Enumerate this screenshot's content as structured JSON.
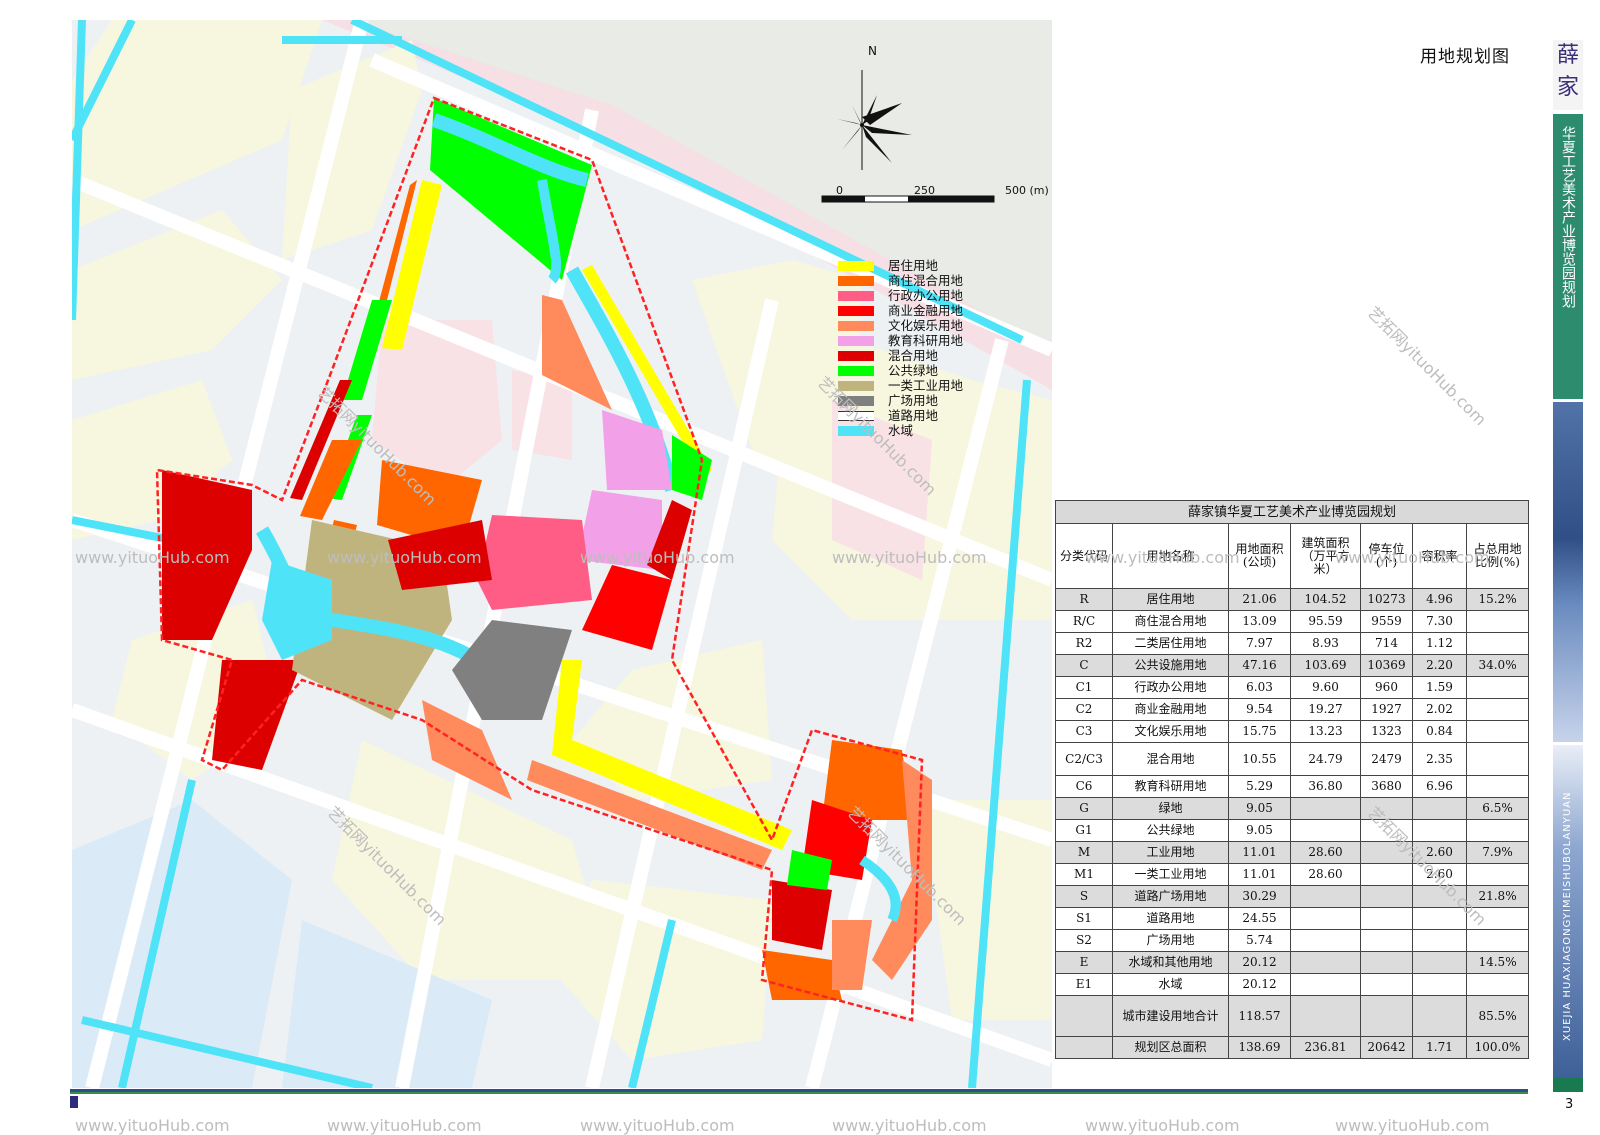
{
  "title": "用地规划图",
  "compass": {
    "north_label": "N"
  },
  "scale_bar": {
    "labels": [
      "0",
      "250",
      "500 (m)"
    ]
  },
  "legend": [
    {
      "label": "居住用地",
      "color": "#ffff00"
    },
    {
      "label": "商住混合用地",
      "color": "#ff6600"
    },
    {
      "label": "行政办公用地",
      "color": "#ff5c86"
    },
    {
      "label": "商业金融用地",
      "color": "#ff0000"
    },
    {
      "label": "文化娱乐用地",
      "color": "#ff8a5c"
    },
    {
      "label": "教育科研用地",
      "color": "#f2a0e8"
    },
    {
      "label": "混合用地",
      "color": "#dd0000"
    },
    {
      "label": "公共绿地",
      "color": "#00ff00"
    },
    {
      "label": "一类工业用地",
      "color": "#c0b47e"
    },
    {
      "label": "广场用地",
      "color": "#808080"
    },
    {
      "label": "道路用地",
      "color": "#ffffff"
    },
    {
      "label": "水域",
      "color": "#4fe3f7"
    }
  ],
  "table": {
    "caption": "薛家镇华夏工艺美术产业博览园规划",
    "headers": [
      "分类代码",
      "用地名称",
      "用地面积(公顷)",
      "建筑面积（万平方米）",
      "停车位(个)",
      "容积率",
      "占总用地比例(%)"
    ],
    "rows": [
      {
        "code": "R",
        "name": "居住用地",
        "area": "21.06",
        "floor": "104.52",
        "parking": "10273",
        "far": "4.96",
        "pct": "15.2%",
        "gray": true
      },
      {
        "code": "R/C",
        "name": "商住混合用地",
        "area": "13.09",
        "floor": "95.59",
        "parking": "9559",
        "far": "7.30",
        "pct": "",
        "gray": false
      },
      {
        "code": "R2",
        "name": "二类居住用地",
        "area": "7.97",
        "floor": "8.93",
        "parking": "714",
        "far": "1.12",
        "pct": "",
        "gray": false
      },
      {
        "code": "C",
        "name": "公共设施用地",
        "area": "47.16",
        "floor": "103.69",
        "parking": "10369",
        "far": "2.20",
        "pct": "34.0%",
        "gray": true
      },
      {
        "code": "C1",
        "name": "行政办公用地",
        "area": "6.03",
        "floor": "9.60",
        "parking": "960",
        "far": "1.59",
        "pct": "",
        "gray": false
      },
      {
        "code": "C2",
        "name": "商业金融用地",
        "area": "9.54",
        "floor": "19.27",
        "parking": "1927",
        "far": "2.02",
        "pct": "",
        "gray": false
      },
      {
        "code": "C3",
        "name": "文化娱乐用地",
        "area": "15.75",
        "floor": "13.23",
        "parking": "1323",
        "far": "0.84",
        "pct": "",
        "gray": false
      },
      {
        "code": "C2/C3",
        "name": "混合用地",
        "area": "10.55",
        "floor": "24.79",
        "parking": "2479",
        "far": "2.35",
        "pct": "",
        "gray": false,
        "tall": true
      },
      {
        "code": "C6",
        "name": "教育科研用地",
        "area": "5.29",
        "floor": "36.80",
        "parking": "3680",
        "far": "6.96",
        "pct": "",
        "gray": false
      },
      {
        "code": "G",
        "name": "绿地",
        "area": "9.05",
        "floor": "",
        "parking": "",
        "far": "",
        "pct": "6.5%",
        "gray": true
      },
      {
        "code": "G1",
        "name": "公共绿地",
        "area": "9.05",
        "floor": "",
        "parking": "",
        "far": "",
        "pct": "",
        "gray": false
      },
      {
        "code": "M",
        "name": "工业用地",
        "area": "11.01",
        "floor": "28.60",
        "parking": "",
        "far": "2.60",
        "pct": "7.9%",
        "gray": true
      },
      {
        "code": "M1",
        "name": "一类工业用地",
        "area": "11.01",
        "floor": "28.60",
        "parking": "",
        "far": "2.60",
        "pct": "",
        "gray": false
      },
      {
        "code": "S",
        "name": "道路广场用地",
        "area": "30.29",
        "floor": "",
        "parking": "",
        "far": "",
        "pct": "21.8%",
        "gray": true
      },
      {
        "code": "S1",
        "name": "道路用地",
        "area": "24.55",
        "floor": "",
        "parking": "",
        "far": "",
        "pct": "",
        "gray": false
      },
      {
        "code": "S2",
        "name": "广场用地",
        "area": "5.74",
        "floor": "",
        "parking": "",
        "far": "",
        "pct": "",
        "gray": false
      },
      {
        "code": "E",
        "name": "水域和其他用地",
        "area": "20.12",
        "floor": "",
        "parking": "",
        "far": "",
        "pct": "14.5%",
        "gray": true
      },
      {
        "code": "E1",
        "name": "水域",
        "area": "20.12",
        "floor": "",
        "parking": "",
        "far": "",
        "pct": "",
        "gray": false
      },
      {
        "code": "",
        "name": "城市建设用地合计",
        "area": "118.57",
        "floor": "",
        "parking": "",
        "far": "",
        "pct": "85.5%",
        "gray": true,
        "tall2": true
      },
      {
        "code": "",
        "name": "规划区总面积",
        "area": "138.69",
        "floor": "236.81",
        "parking": "20642",
        "far": "1.71",
        "pct": "100.0%",
        "gray": true
      }
    ]
  },
  "side": {
    "logo_text": "薛家",
    "project_name": "华夏工艺美术产业博览园规划",
    "english": "XUEJIA HUAXIAGONGYIMEISHUBOLANYUAN",
    "page_number": "3"
  },
  "watermark": "www.yituoHub.com",
  "watermark_cn": "艺拓网yituoHub.com"
}
